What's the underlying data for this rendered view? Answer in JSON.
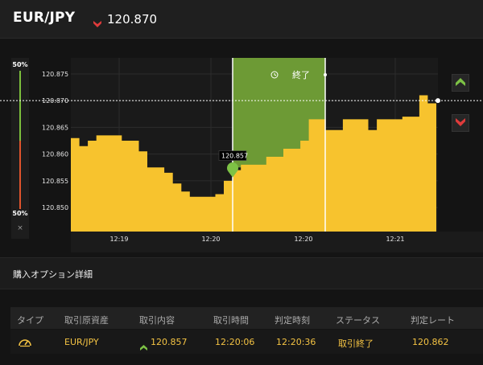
{
  "header": {
    "pair": "EUR/JPY",
    "direction_icon": "red-down-arrow-icon",
    "rate": "120.870"
  },
  "gauge": {
    "top_label": "50%",
    "bottom_label": "50%",
    "close": "×",
    "top_fraction": 0.5,
    "bottom_fraction": 0.5
  },
  "chart_data": {
    "type": "area",
    "y_ticks": [
      "120.875",
      "120.870",
      "120.865",
      "120.860",
      "120.855",
      "120.850"
    ],
    "x_ticks": [
      "12:19",
      "12:20",
      "12:20",
      "12:21"
    ],
    "ylim": [
      120.8455,
      120.878
    ],
    "current_rate": 120.87,
    "entry_label": "120.857",
    "entry_value": 120.857,
    "expiry_label": "終了",
    "colors": {
      "area": "#f7c32e",
      "window": "#6d9a35",
      "background": "#1a1a1a"
    },
    "values": [
      120.863,
      120.8615,
      120.8625,
      120.8635,
      120.8635,
      120.8635,
      120.8625,
      120.8625,
      120.8605,
      120.8575,
      120.8575,
      120.8565,
      120.8545,
      120.853,
      120.852,
      120.852,
      120.852,
      120.8525,
      120.855,
      120.857,
      120.858,
      120.858,
      120.858,
      120.8595,
      120.8595,
      120.861,
      120.861,
      120.8625,
      120.8665,
      120.8665,
      120.8645,
      120.8645,
      120.8665,
      120.8665,
      120.8665,
      120.8645,
      120.8665,
      120.8665,
      120.8665,
      120.867,
      120.867,
      120.871,
      120.8695,
      120.8695
    ]
  },
  "side_buttons": {
    "up_icon": "green-up-arrow-icon",
    "down_icon": "red-down-arrow-icon"
  },
  "details": {
    "title": "購入オプション詳細",
    "columns": [
      "タイプ",
      "取引原資産",
      "取引内容",
      "取引時間",
      "判定時刻",
      "ステータス",
      "判定レート"
    ],
    "row": {
      "type_icon": "gauge-icon",
      "asset": "EUR/JPY",
      "direction_icon": "green-up-arrow-icon",
      "trade": "120.857",
      "trade_time": "12:20:06",
      "judge_time": "12:20:36",
      "status": "取引終了",
      "judge_rate": "120.862"
    }
  }
}
